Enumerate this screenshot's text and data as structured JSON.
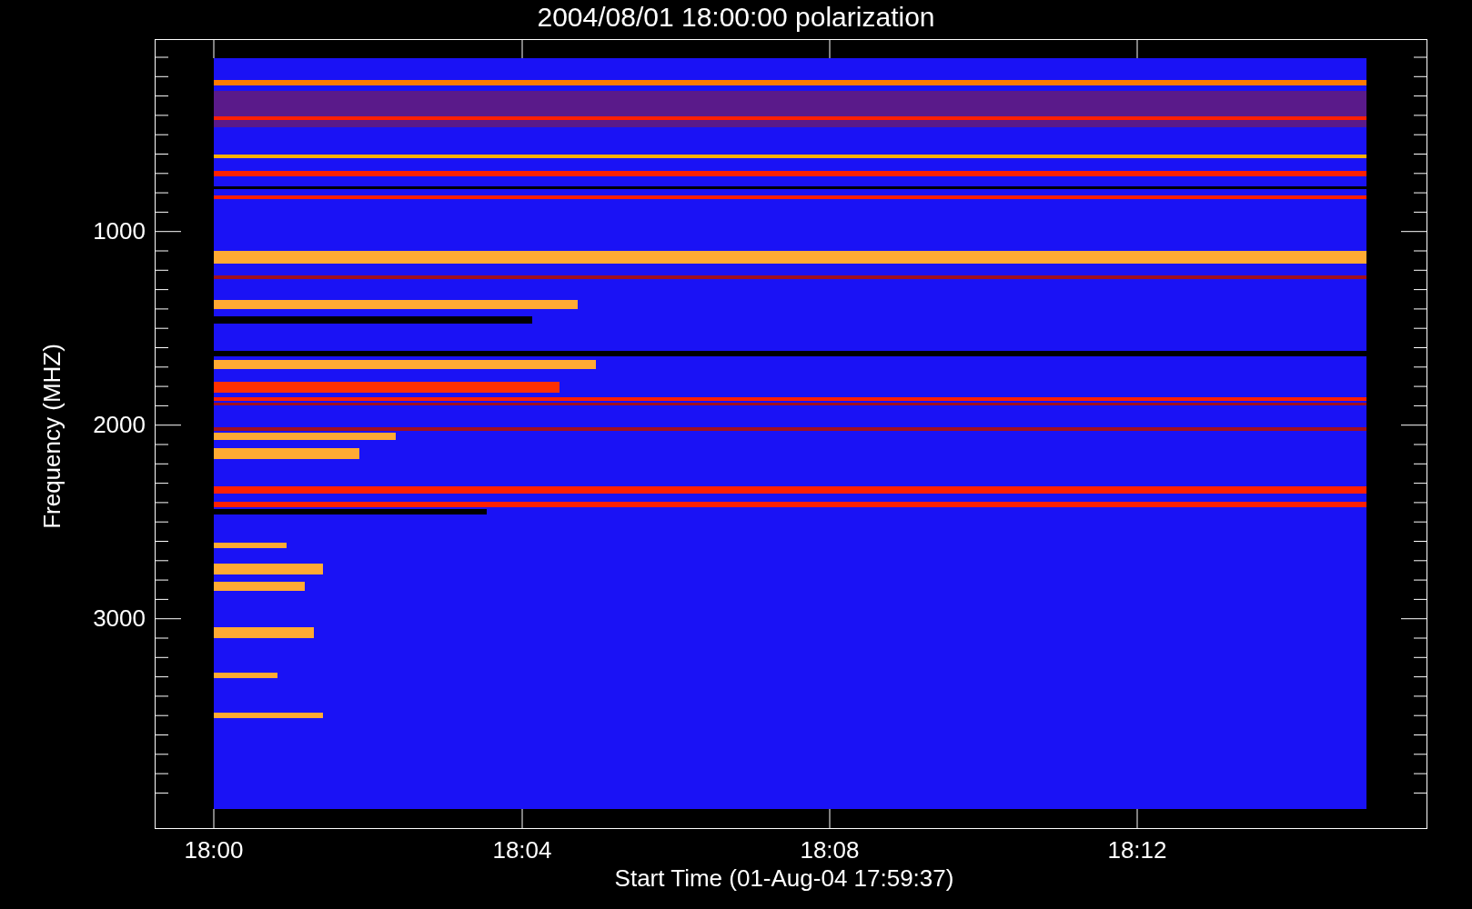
{
  "plot": {
    "title": "2004/08/01 18:00:00 polarization",
    "x_axis": {
      "label": "Start Time (01-Aug-04 17:59:37)",
      "ticks": [
        "18:00",
        "18:04",
        "18:08",
        "18:12"
      ]
    },
    "y_axis": {
      "label": "Frequency (MHZ)",
      "ticks": [
        "1000",
        "2000",
        "3000"
      ]
    }
  }
}
